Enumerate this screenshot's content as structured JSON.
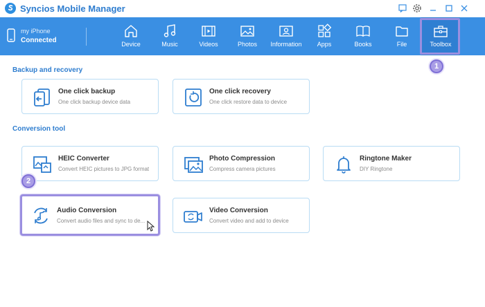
{
  "window": {
    "title": "Syncios Mobile Manager",
    "controls": [
      "feedback-icon",
      "gear-icon",
      "minimize-icon",
      "maximize-icon",
      "close-icon"
    ]
  },
  "device": {
    "name": "my iPhone",
    "status": "Connected"
  },
  "nav": {
    "items": [
      {
        "label": "Device",
        "icon": "home-icon"
      },
      {
        "label": "Music",
        "icon": "music-note-icon"
      },
      {
        "label": "Videos",
        "icon": "film-icon"
      },
      {
        "label": "Photos",
        "icon": "image-icon"
      },
      {
        "label": "Information",
        "icon": "contact-card-icon"
      },
      {
        "label": "Apps",
        "icon": "apps-grid-icon"
      },
      {
        "label": "Books",
        "icon": "book-icon"
      },
      {
        "label": "File",
        "icon": "folder-icon"
      },
      {
        "label": "Toolbox",
        "icon": "toolbox-icon"
      }
    ],
    "active": "Toolbox"
  },
  "steps": {
    "one": "1",
    "two": "2"
  },
  "sections": {
    "backup": {
      "title": "Backup and recovery",
      "cards": [
        {
          "title": "One click backup",
          "desc": "One click backup device data",
          "icon": "backup-icon"
        },
        {
          "title": "One click recovery",
          "desc": "One click restore data to device",
          "icon": "recovery-icon"
        }
      ]
    },
    "conversion": {
      "title": "Conversion tool",
      "cards": [
        {
          "title": "HEIC Converter",
          "desc": "Convert HEIC pictures to JPG format",
          "icon": "heic-icon"
        },
        {
          "title": "Photo Compression",
          "desc": "Compress camera pictures",
          "icon": "photo-compress-icon"
        },
        {
          "title": "Ringtone Maker",
          "desc": "DIY Ringtone",
          "icon": "bell-icon"
        },
        {
          "title": "Audio Conversion",
          "desc": "Convert audio files and sync to de...",
          "icon": "audio-convert-icon"
        },
        {
          "title": "Video Conversion",
          "desc": "Convert video and add to device",
          "icon": "video-convert-icon"
        }
      ]
    }
  },
  "colors": {
    "accent": "#3a8fe3",
    "highlight": "#9b8fe0",
    "title": "#2e7dcf",
    "icon": "#2e7dcf"
  }
}
